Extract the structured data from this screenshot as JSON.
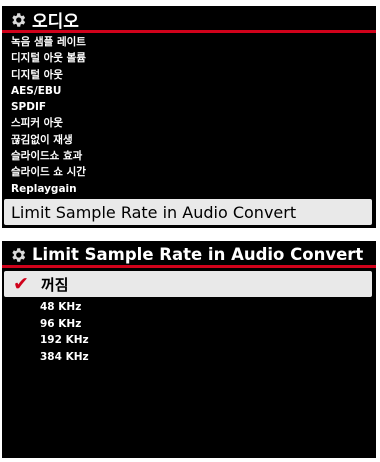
{
  "top_menu": {
    "title": "오디오",
    "icon": "gear-icon",
    "items": [
      {
        "label": "녹음 샘플 레이트"
      },
      {
        "label": "디지털 아웃 볼륨"
      },
      {
        "label": "디지털 아웃"
      },
      {
        "label": "AES/EBU"
      },
      {
        "label": "SPDIF"
      },
      {
        "label": "스피커 아웃"
      },
      {
        "label": "끊김없이 재생"
      },
      {
        "label": "슬라이드쇼 효과"
      },
      {
        "label": "슬라이드 쇼 시간"
      },
      {
        "label": "Replaygain"
      }
    ],
    "selected_item": "Limit Sample Rate in Audio Convert"
  },
  "sub_menu": {
    "title": "Limit Sample Rate in Audio Convert",
    "icon": "gear-icon",
    "selected_option": "꺼짐",
    "check_mark": "✔",
    "options": [
      {
        "label": "48 KHz"
      },
      {
        "label": "96 KHz"
      },
      {
        "label": "192 KHz"
      },
      {
        "label": "384 KHz"
      }
    ]
  },
  "colors": {
    "background": "#000000",
    "accent": "#d0021b",
    "selection": "#e9e9e9",
    "text": "#ffffff"
  }
}
